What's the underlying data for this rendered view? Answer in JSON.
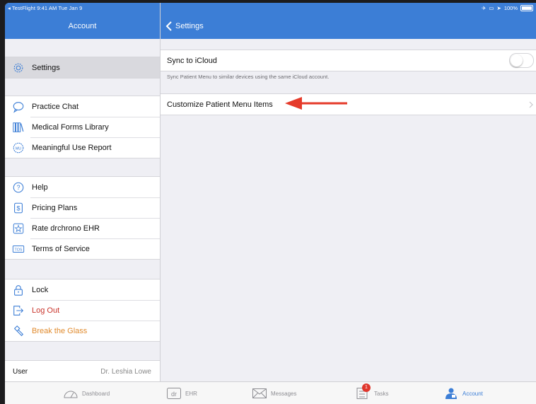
{
  "status_bar": {
    "left": "◂ TestFlight  9:41 AM  Tue Jan 9",
    "right": "100%"
  },
  "sidebar": {
    "title": "Account",
    "groups": [
      {
        "items": [
          {
            "label": "Settings",
            "icon": "gear-icon",
            "selected": true
          }
        ]
      },
      {
        "items": [
          {
            "label": "Practice Chat",
            "icon": "chat-bubble-icon"
          },
          {
            "label": "Medical Forms Library",
            "icon": "books-icon"
          },
          {
            "label": "Meaningful Use Report",
            "icon": "mu-badge-icon"
          }
        ]
      },
      {
        "items": [
          {
            "label": "Help",
            "icon": "question-icon"
          },
          {
            "label": "Pricing Plans",
            "icon": "dollar-icon"
          },
          {
            "label": "Rate drchrono EHR",
            "icon": "star-icon"
          },
          {
            "label": "Terms of Service",
            "icon": "tos-icon"
          }
        ]
      },
      {
        "items": [
          {
            "label": "Lock",
            "icon": "lock-icon"
          },
          {
            "label": "Log Out",
            "icon": "logout-icon",
            "color": "#c9342b"
          },
          {
            "label": "Break the Glass",
            "icon": "hammer-icon",
            "color": "#e08a2c"
          }
        ]
      }
    ],
    "user": {
      "label": "User",
      "value": "Dr. Leshia Lowe"
    }
  },
  "settings": {
    "back_label": "Settings",
    "sync_label": "Sync to iCloud",
    "sync_enabled": false,
    "sync_note": "Sync Patient Menu to similar devices using the same iCloud account.",
    "customize_label": "Customize Patient Menu Items"
  },
  "tabbar": {
    "tabs": [
      {
        "label": "Dashboard",
        "icon": "speedometer-icon"
      },
      {
        "label": "EHR",
        "icon": "dr-icon"
      },
      {
        "label": "Messages",
        "icon": "envelope-icon"
      },
      {
        "label": "Tasks",
        "icon": "checklist-icon",
        "badge": "1"
      },
      {
        "label": "Account",
        "icon": "person-icon",
        "active": true
      }
    ]
  },
  "colors": {
    "accent": "#3c7ed6",
    "danger": "#c9342b",
    "warning": "#e08a2c",
    "badge": "#e0362c",
    "annotation_arrow": "#e53a2a"
  }
}
